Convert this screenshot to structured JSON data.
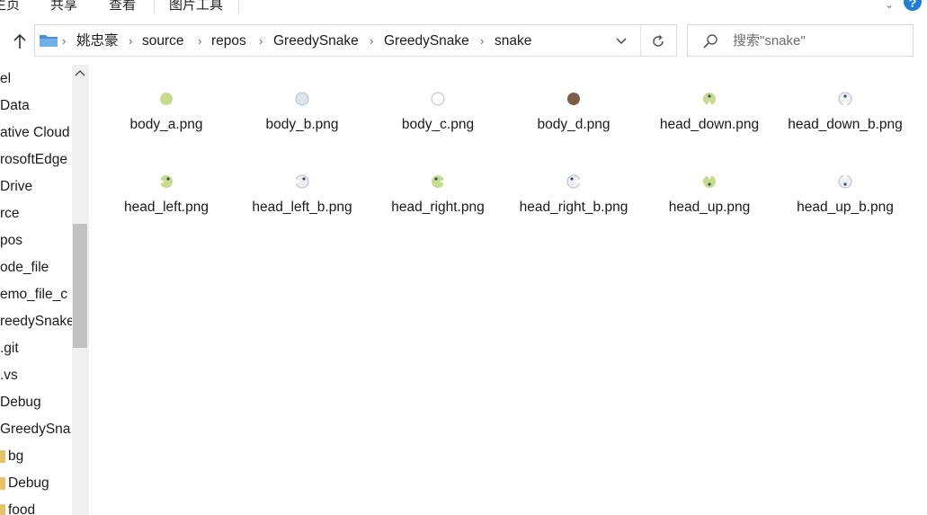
{
  "ribbon": {
    "tabs": [
      {
        "id": "home",
        "label": "主页"
      },
      {
        "id": "share",
        "label": "共享"
      },
      {
        "id": "view",
        "label": "查看"
      },
      {
        "id": "picture-tools",
        "label": "图片工具"
      }
    ],
    "help_label": "?"
  },
  "address": {
    "crumbs": [
      "姚忠豪",
      "source",
      "repos",
      "GreedySnake",
      "GreedySnake",
      "snake"
    ]
  },
  "search": {
    "placeholder": "搜索\"snake\""
  },
  "nav": {
    "items": [
      {
        "label": "el",
        "folder": false
      },
      {
        "label": "Data",
        "folder": false
      },
      {
        "label": "ative Cloud",
        "folder": false
      },
      {
        "label": "rosoftEdge",
        "folder": false
      },
      {
        "label": "Drive",
        "folder": false
      },
      {
        "label": "rce",
        "folder": false
      },
      {
        "label": "pos",
        "folder": false
      },
      {
        "label": "ode_file",
        "folder": false
      },
      {
        "label": "emo_file_c",
        "folder": false
      },
      {
        "label": "reedySnake",
        "folder": false
      },
      {
        "label": ".git",
        "folder": false
      },
      {
        "label": ".vs",
        "folder": false
      },
      {
        "label": "Debug",
        "folder": false
      },
      {
        "label": "GreedySna",
        "folder": false
      },
      {
        "label": "bg",
        "folder": true
      },
      {
        "label": "Debug",
        "folder": true
      },
      {
        "label": "food",
        "folder": true
      }
    ]
  },
  "files": [
    {
      "name": "body_a.png",
      "icon": "green-circle",
      "color": "#c5dc8a"
    },
    {
      "name": "body_b.png",
      "icon": "light-circle",
      "color": "#dfe3ea"
    },
    {
      "name": "body_c.png",
      "icon": "white-circle",
      "color": "#ffffff"
    },
    {
      "name": "body_d.png",
      "icon": "brown-circle",
      "color": "#7d5c48"
    },
    {
      "name": "head_down.png",
      "icon": "snake-head-down",
      "color": "#c5dc8a"
    },
    {
      "name": "head_down_b.png",
      "icon": "snake-head-down-b",
      "color": "#eef0f5"
    },
    {
      "name": "head_left.png",
      "icon": "snake-head-left",
      "color": "#c5dc8a"
    },
    {
      "name": "head_left_b.png",
      "icon": "snake-head-left-b",
      "color": "#eef0f5"
    },
    {
      "name": "head_right.png",
      "icon": "snake-head-right",
      "color": "#c5dc8a"
    },
    {
      "name": "head_right_b.png",
      "icon": "snake-head-right-b",
      "color": "#eef0f5"
    },
    {
      "name": "head_up.png",
      "icon": "snake-head-up",
      "color": "#c5dc8a"
    },
    {
      "name": "head_up_b.png",
      "icon": "snake-head-up-b",
      "color": "#eef0f5"
    }
  ]
}
